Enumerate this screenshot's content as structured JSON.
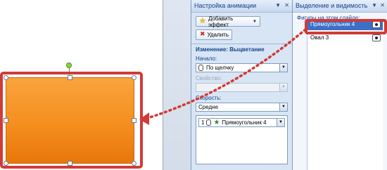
{
  "animation_pane": {
    "title": "Настройка анимации",
    "add_effect_label": "Добавить эффект",
    "remove_label": "Удалить",
    "section_heading": "Изменение: Выцветание",
    "start_label": "Начало:",
    "start_value": "По щелчку",
    "property_label": "Свойство:",
    "property_value": "",
    "speed_label": "Скорость:",
    "speed_value": "Средне",
    "list_items": [
      {
        "index": "1",
        "name": "Прямоугольник 4"
      }
    ]
  },
  "selection_pane": {
    "title": "Выделение и видимость",
    "subtitle": "Фигуры на этом слайде:",
    "items": [
      {
        "name": "Прямоугольник 4",
        "selected": true
      },
      {
        "name": "Овал 3",
        "selected": false
      }
    ]
  },
  "colors": {
    "shape_fill": "#f58e1e",
    "highlight": "#d23a36",
    "selected_item": "#3b6fc8"
  }
}
